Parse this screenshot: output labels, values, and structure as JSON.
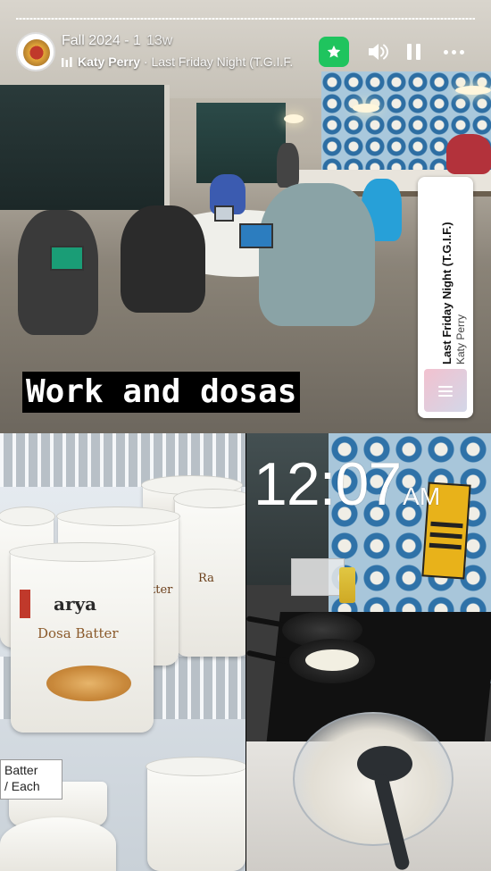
{
  "header": {
    "story_title": "Fall 2024 - 1",
    "time_ago": "13w",
    "music_artist": "Katy Perry",
    "music_separator": " · ",
    "music_song": "Last Friday Night (T.G.I.F.",
    "accent_color": "#1fc45e",
    "icons": [
      "star-icon",
      "speaker-icon",
      "pause-icon",
      "more-icon"
    ]
  },
  "top_photo": {
    "caption": "Work and dosas"
  },
  "music_sticker": {
    "song_title": "Last Friday Night (T.G.I.F.)",
    "artist": "Katy Perry"
  },
  "fridge_photo": {
    "brand": "arya",
    "product": "Dosa Batter",
    "side_label_1": "tter",
    "side_label_2": "Ra",
    "price_tag_line1": "Batter",
    "price_tag_line2": "/ Each"
  },
  "kitchen_photo": {
    "clock_time": "12:07",
    "clock_ampm": "AM"
  }
}
